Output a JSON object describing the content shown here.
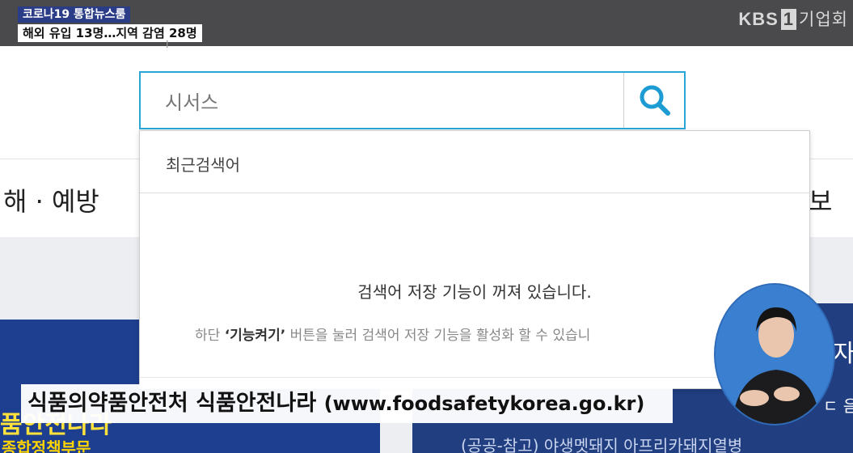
{
  "broadcast": {
    "tag": "코로나19 통합뉴스룸",
    "headline": "해외 유입 13명…지역 감염 28명",
    "brand_prefix": "KBS",
    "brand_number": "1",
    "brand_suffix": "기업회"
  },
  "search": {
    "query": "시서스",
    "button_icon": "search-icon"
  },
  "nav": {
    "left_partial": "해 · 예방",
    "right_partial": "보"
  },
  "dropdown": {
    "title": "최근검색어",
    "message": "검색어 저장 기능이 꺼져 있습니다.",
    "sub_prefix": "하단 ",
    "sub_highlight": "‘기능켜기’",
    "sub_suffix": " 버튼을 눌러 검색어 저장 기능을 활성화 할 수 있습니"
  },
  "caption": {
    "title": "식품의약품안전처 식품안전나라",
    "url": "(www.foodsafetykorea.go.kr)"
  },
  "background": {
    "left_banner_text": "품안전나라",
    "left_banner_text2": "종합정책부문",
    "right_text_1": "자",
    "right_text_2": "ㄷ 음",
    "right_text_3": "(공공-참고) 야생멧돼지 아프리카돼지열병"
  },
  "colors": {
    "top_bar": "#4a4a4c",
    "search_accent": "#2aa6d6",
    "banner_blue": "#1e3f8f"
  }
}
